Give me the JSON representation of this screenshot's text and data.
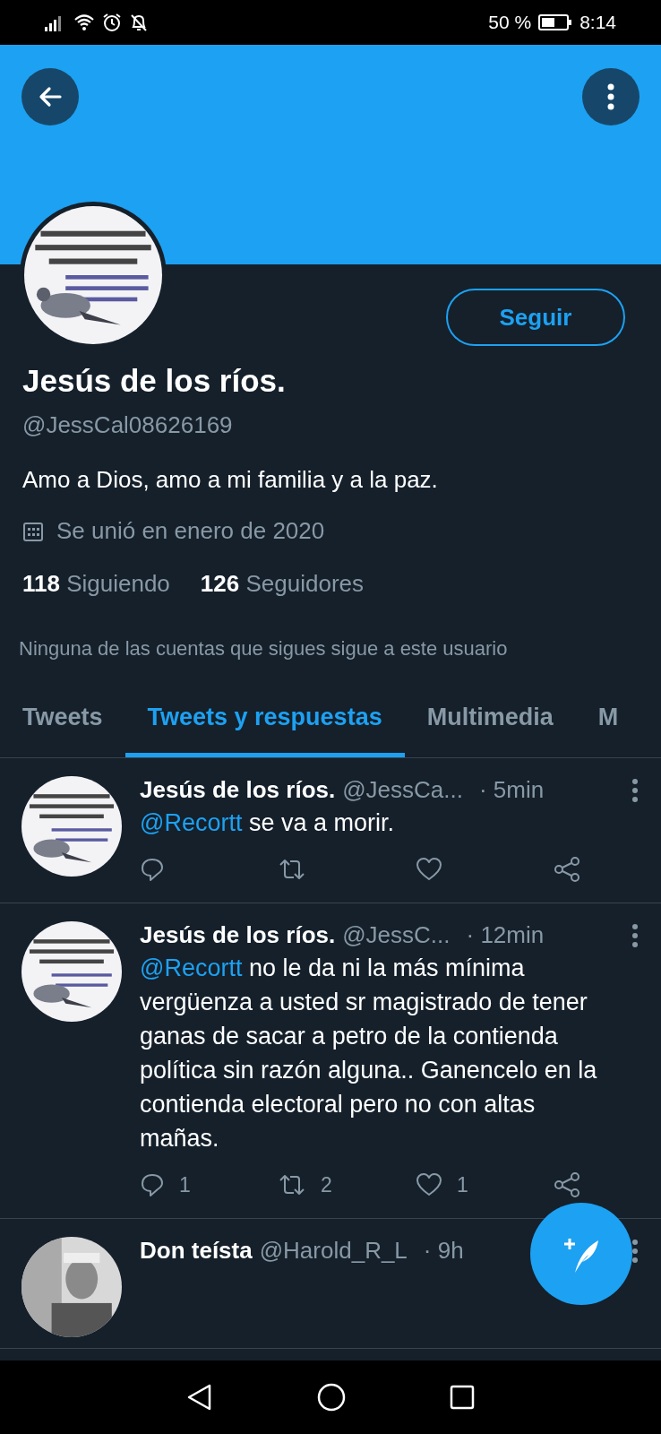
{
  "status_bar": {
    "battery": "50 %",
    "time": "8:14"
  },
  "profile": {
    "follow_button": "Seguir",
    "name": "Jesús de los ríos.",
    "handle": "@JessCal08626169",
    "bio": "Amo a Dios, amo a mi familia y a la paz.",
    "joined": "Se unió en enero de 2020",
    "stats": [
      {
        "count": "118",
        "label": "Siguiendo"
      },
      {
        "count": "126",
        "label": "Seguidores"
      }
    ],
    "followers_note": "Ninguna de las cuentas que sigues sigue a este usuario"
  },
  "tabs": [
    {
      "label": "Tweets",
      "selected": false
    },
    {
      "label": "Tweets y respuestas",
      "selected": true
    },
    {
      "label": "Multimedia",
      "selected": false
    },
    {
      "label": "M",
      "selected": false
    }
  ],
  "tweets": [
    {
      "name": "Jesús de los ríos.",
      "handle": "@JessCa...",
      "time": "· 5min",
      "mention": "@Recortt",
      "text": "se va a morir."
    },
    {
      "name": "Jesús de los ríos.",
      "handle": "@JessC...",
      "time": "· 12min",
      "mention": "@Recortt",
      "text": "no le da ni la más mínima vergüenza a usted sr magistrado de tener ganas de sacar a petro de la contienda política sin razón alguna.. Ganencelo en la contienda electoral pero no con altas mañas.",
      "replies": "1",
      "retweets": "2",
      "likes": "1"
    },
    {
      "name": "Don teísta",
      "handle": "@Harold_R_L",
      "time": "· 9h"
    }
  ]
}
